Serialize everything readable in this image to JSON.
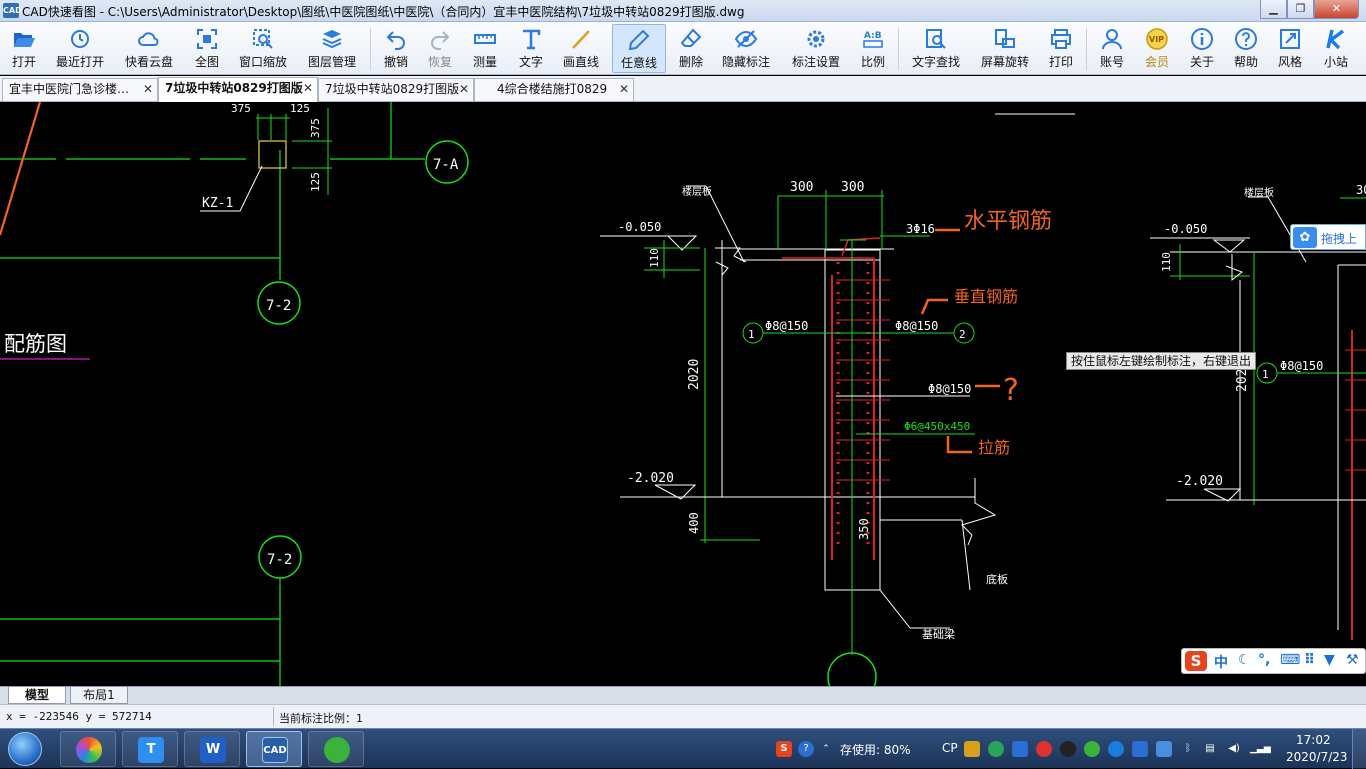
{
  "window": {
    "title": "CAD快速看图 - C:\\Users\\Administrator\\Desktop\\图纸\\中医院图纸\\中医院\\（合同内）宜丰中医院结构\\7垃圾中转站0829打图版.dwg",
    "icon_label": "CAD",
    "controls": {
      "minimize": "▁",
      "maximize": "❐",
      "close": "✕"
    }
  },
  "toolbar": {
    "items": [
      {
        "label": "打开",
        "icon": "folder-open-icon"
      },
      {
        "label": "最近打开",
        "icon": "recent-clock-icon"
      },
      {
        "label": "快看云盘",
        "icon": "cloud-icon"
      },
      {
        "label": "全图",
        "icon": "fit-all-icon"
      },
      {
        "label": "窗口缩放",
        "icon": "zoom-window-icon"
      },
      {
        "label": "图层管理",
        "icon": "layers-icon"
      },
      {
        "label": "撤销",
        "icon": "undo-icon"
      },
      {
        "label": "恢复",
        "icon": "redo-icon"
      },
      {
        "label": "测量",
        "icon": "measure-icon"
      },
      {
        "label": "文字",
        "icon": "text-icon"
      },
      {
        "label": "画直线",
        "icon": "line-icon"
      },
      {
        "label": "任意线",
        "icon": "pen-icon"
      },
      {
        "label": "删除",
        "icon": "eraser-icon"
      },
      {
        "label": "隐藏标注",
        "icon": "eye-hide-icon"
      },
      {
        "label": "标注设置",
        "icon": "settings-gear-icon"
      },
      {
        "label": "比例",
        "icon": "scale-ab-icon"
      },
      {
        "label": "文字查找",
        "icon": "text-search-icon"
      },
      {
        "label": "屏幕旋转",
        "icon": "rotate-screen-icon"
      },
      {
        "label": "打印",
        "icon": "printer-icon"
      },
      {
        "label": "账号",
        "icon": "user-icon"
      },
      {
        "label": "会员",
        "icon": "vip-badge-icon"
      },
      {
        "label": "关于",
        "icon": "info-icon"
      },
      {
        "label": "帮助",
        "icon": "help-icon"
      },
      {
        "label": "风格",
        "icon": "style-expand-icon"
      },
      {
        "label": "小站",
        "icon": "k-site-icon"
      }
    ],
    "active": "任意线",
    "disabled": [
      "恢复"
    ]
  },
  "tabs": [
    {
      "label": "宜丰中医院门急诊楼…",
      "close": "✕"
    },
    {
      "label": "7垃圾中转站0829打图版",
      "close": "✕",
      "active": true
    },
    {
      "label": "7垃圾中转站0829打图版",
      "close": "✕"
    },
    {
      "label": "4综合楼结施打0829",
      "close": "✕"
    }
  ],
  "drawing": {
    "left": {
      "dims_top": [
        "375",
        "125"
      ],
      "dim_v": [
        "375",
        "125"
      ],
      "column_tag": "KZ-1",
      "axis_tags": [
        "7-A",
        "7-2",
        "7-2"
      ],
      "section_title": "配筋图"
    },
    "center": {
      "dims_top": [
        "300",
        "300"
      ],
      "slab_label_top": "楼层板",
      "elevation_top": "-0.050",
      "dim_110": "110",
      "rebar_top": "3Φ16",
      "note_horizontal": "水平钢筋",
      "note_vertical": "垂直钢筋",
      "axis_left": "1",
      "axis_right": "2",
      "rebar_left": "Φ8@150",
      "rebar_right": "Φ8@150",
      "rebar_mid": "Φ8@150",
      "question_mark": "?",
      "rebar_tie": "Φ6@450x450",
      "note_tie": "拉筋",
      "dim_height": "2020",
      "elevation_bottom": "-2.020",
      "dim_400": "400",
      "dim_350": "350",
      "bottom_slab": "底板",
      "foundation_beam": "基础梁"
    },
    "right": {
      "slab_label": "楼层板",
      "elevation_top": "-0.050",
      "dim_110": "110",
      "dim_height": "2020",
      "axis": "1",
      "rebar": "Φ8@150",
      "elevation_bottom": "-2.020",
      "dim_top": "30"
    }
  },
  "hint": "按住鼠标左键绘制标注，右键退出",
  "drag_upload": {
    "label": "拖拽上"
  },
  "ime": {
    "logo": "S",
    "mode": "中"
  },
  "layout_tabs": [
    "模型",
    "布局1"
  ],
  "status": {
    "coords": "x = -223546  y = 572714",
    "scale": "当前标注比例：1"
  },
  "taskbar": {
    "apps": [
      {
        "name": "photo-app",
        "label": ""
      },
      {
        "name": "typora-app",
        "label": "T"
      },
      {
        "name": "wps-app",
        "label": "W"
      },
      {
        "name": "cad-app",
        "label": "CAD"
      },
      {
        "name": "wechat-app",
        "label": ""
      }
    ],
    "tray": {
      "sogou": "S",
      "memory": "存使用: 80%",
      "cp": "CP"
    },
    "clock": {
      "time": "17:02",
      "date": "2020/7/23"
    }
  },
  "colors": {
    "canvas_bg": "#000000",
    "cad_green": "#18e018",
    "cad_white": "#ffffff",
    "cad_red": "#e02020",
    "annot_orange": "#f0641e",
    "accent_blue": "#2f6fb8"
  }
}
